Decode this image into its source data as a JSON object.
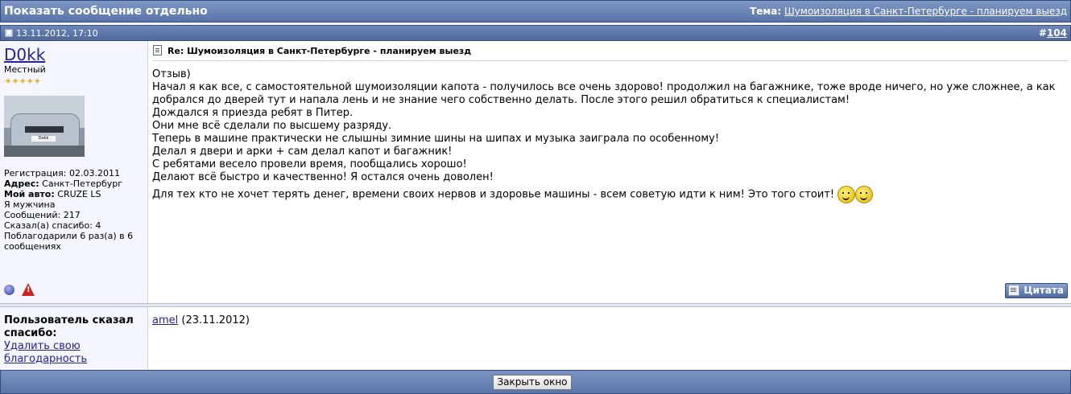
{
  "header": {
    "title": "Показать сообщение отдельно",
    "thread_label": "Тема:",
    "thread_link": "Шумоизоляция в Санкт-Петербурге - планируем выезд"
  },
  "post": {
    "date": "13.11.2012, 17:10",
    "number_prefix": "#",
    "number": "104",
    "title": "Re: Шумоизоляция в Санкт-Петербурге - планируем выезд",
    "lines": [
      "Отзыв)",
      "Начал я как все, с самостоятельной шумоизоляции капота - получилось все очень здорово! продолжил на багажнике, тоже вроде ничего, но уже сложнее, а как добрался до дверей тут и напала лень и не знание чего собственно делать. После этого решил обратиться к специалистам!",
      "Дождался я приезда ребят в Питер.",
      "Они мне всё сделали по высшему разряду.",
      "Теперь в машине практически не слышны зимние шины на шипах и музыка заиграла по особенному!",
      "Делал я двери и арки + сам делал капот и багажник!",
      "С ребятами весело провели время, пообщались хорошо!",
      "Делают всё быстро и качественно! Я остался очень доволен!",
      "Для тех кто не хочет терять денег, времени своих нервов и здоровье машины - всем советую идти к ним! Это того стоит!"
    ],
    "quote_label": "Цитата"
  },
  "user": {
    "name": "D0kk",
    "title": "Местный",
    "stars": "✦✦✦✦✦",
    "avatar_plate": "Dokk",
    "reg_label": "Регистрация:",
    "reg_value": "02.03.2011",
    "address_label": "Адрес:",
    "address_value": "Санкт-Петербург",
    "car_label": "Мой авто:",
    "car_value": "CRUZE LS",
    "gender": "Я мужчина",
    "posts_label": "Сообщений:",
    "posts_value": "217",
    "thanks_said_label": "Сказал(а) спасибо:",
    "thanks_said_value": "4",
    "thanked_text": "Поблагодарили 6 раз(а) в 6 сообщениях"
  },
  "thanks": {
    "heading": "Пользователь сказал спасибо:",
    "remove_label": "Удалить свою благодарность",
    "user_link": "amel",
    "user_date": "(23.11.2012)"
  },
  "footer": {
    "close_label": "Закрыть окно"
  }
}
